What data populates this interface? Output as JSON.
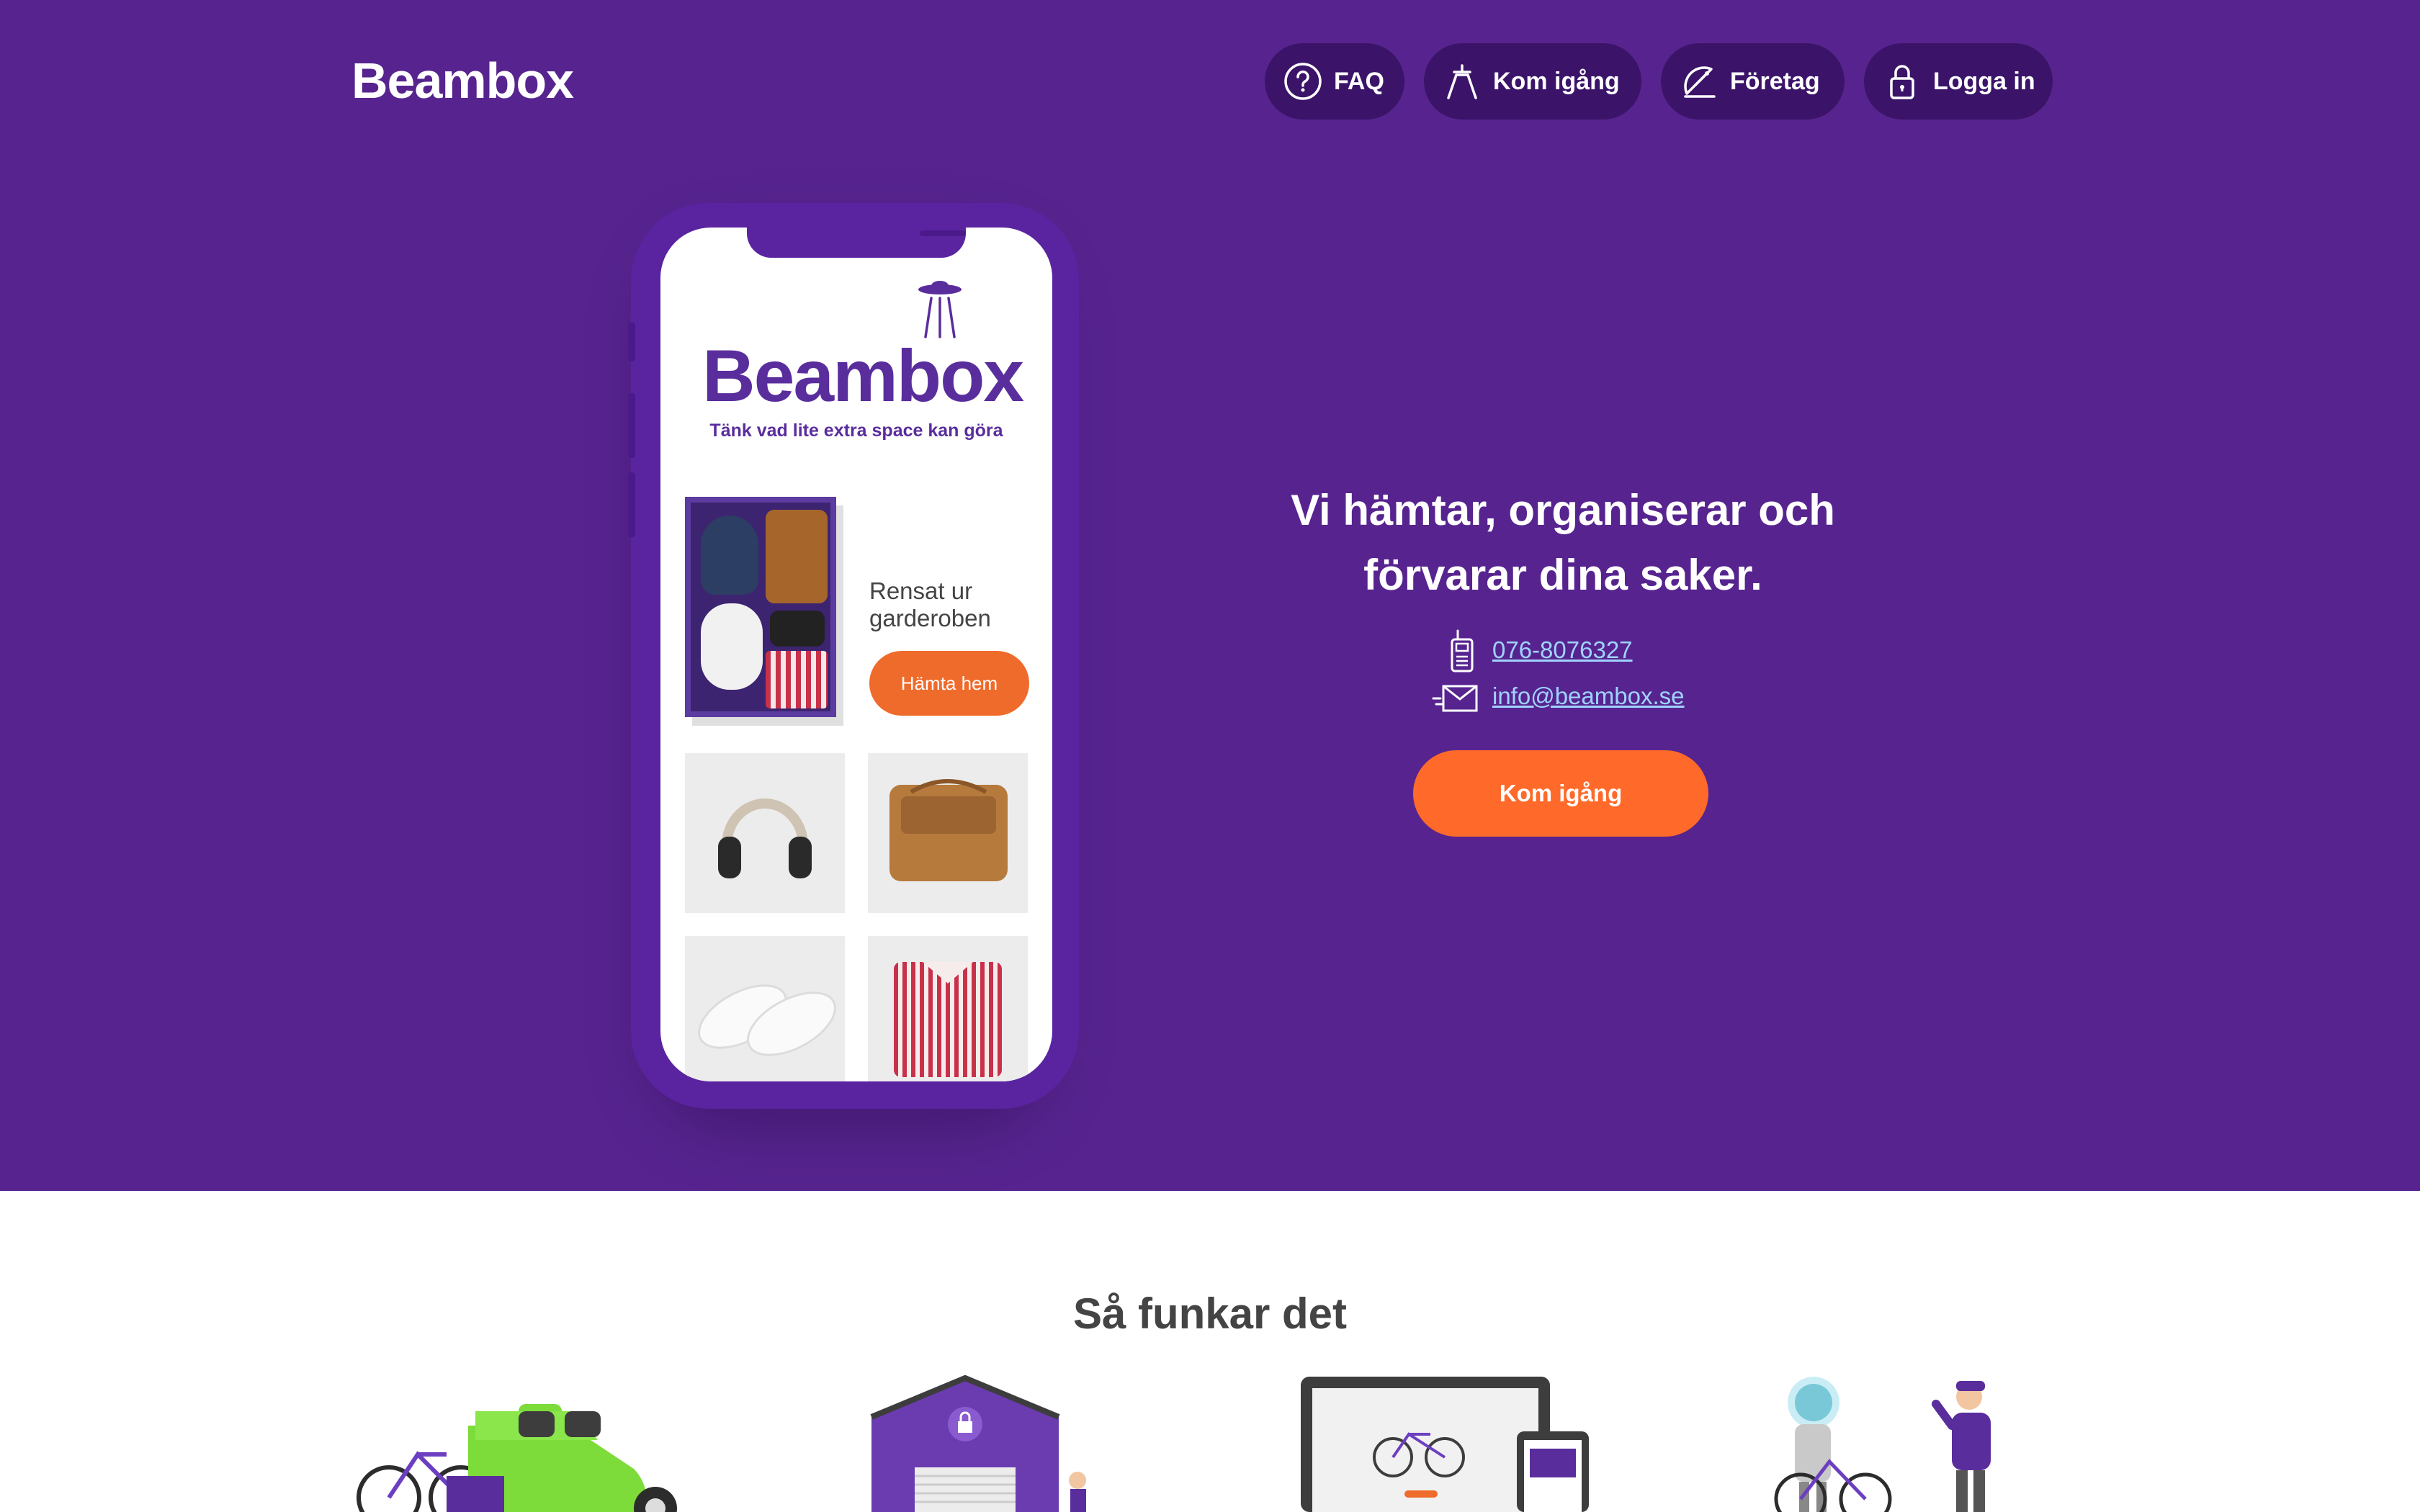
{
  "header": {
    "logo": "Beambox",
    "nav": [
      {
        "label": "FAQ",
        "icon": "question-circle-icon"
      },
      {
        "label": "Kom igång",
        "icon": "ufo-beam-icon"
      },
      {
        "label": "Företag",
        "icon": "satellite-dish-icon"
      },
      {
        "label": "Logga in",
        "icon": "lock-icon"
      }
    ]
  },
  "phone_app": {
    "logo": "Beambox",
    "tagline": "Tänk vad lite extra space kan göra",
    "card_text": "Rensat ur garderoben",
    "card_button": "Hämta hem",
    "thumbnails": [
      "headphones",
      "leather-bag",
      "sneakers",
      "striped-shirt"
    ]
  },
  "hero": {
    "headline_line1": "Vi hämtar, organiserar och",
    "headline_line2": "förvarar dina saker.",
    "phone": "076-8076327",
    "email": "info@beambox.se",
    "cta": "Kom igång"
  },
  "how_it_works": {
    "title": "Så funkar det"
  },
  "colors": {
    "hero_bg": "#57248f",
    "nav_pill": "#3b1469",
    "cta_orange": "#ff6a2a",
    "link_blue": "#9fd3ff",
    "brand_purple": "#5a2d9d"
  }
}
